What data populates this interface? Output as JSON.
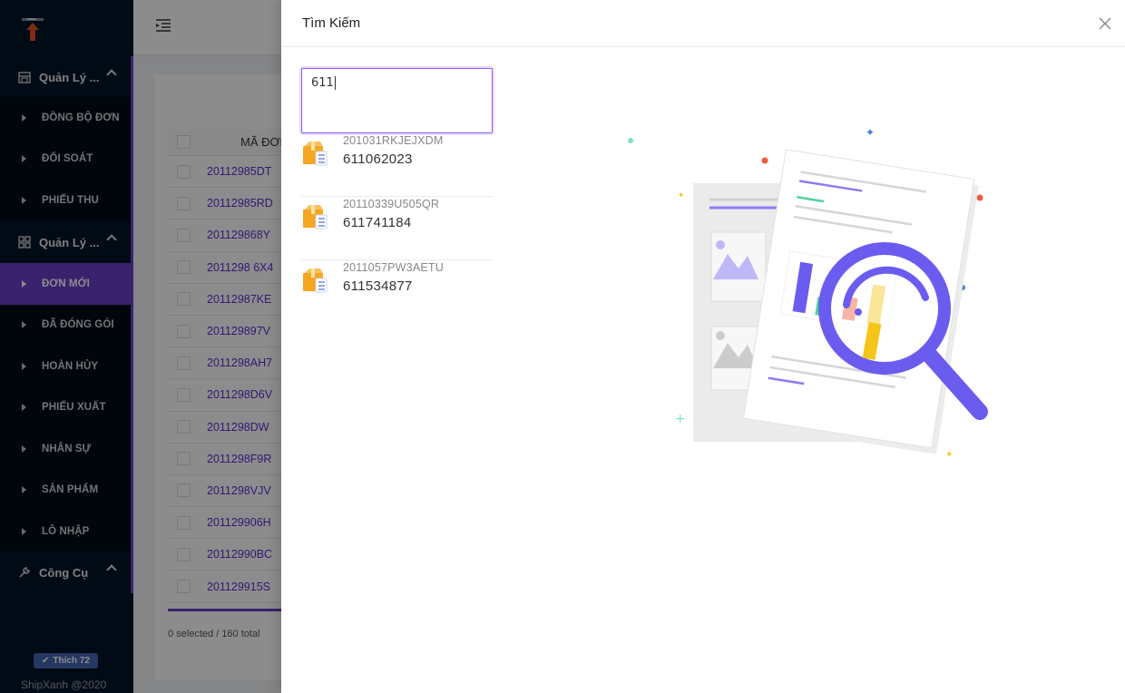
{
  "sidebar": {
    "groups": [
      {
        "label": "Quản Lý ...",
        "icon": "store-icon"
      },
      {
        "label": "Quản Lý ...",
        "icon": "grid-icon"
      },
      {
        "label": "Công Cụ",
        "icon": "wrench-icon"
      }
    ],
    "group1_items": [
      "ĐỒNG BỘ ĐƠN",
      "ĐỐI SOÁT",
      "PHIẾU THU"
    ],
    "group2_items": [
      "ĐƠN MỚI",
      "ĐÃ ĐÓNG GÓI",
      "HOÀN HỦY",
      "PHIẾU XUẤT",
      "NHÂN SỰ",
      "SẢN PHẨM",
      "LÔ NHẬP"
    ],
    "like_button": "Thích 72",
    "copyright": "ShipXanh @2020"
  },
  "table": {
    "header": "MÃ ĐƠN",
    "rows": [
      "20112985DT",
      "20112985RD",
      "201129868Y",
      "2011298 6X4",
      "20112987KE",
      "201129897V",
      "2011298AH7",
      "2011298D6V",
      "2011298DW",
      "2011298F9R",
      "2011298VJV",
      "201129906H",
      "20112990BC",
      "201129915S"
    ],
    "footer": "0 selected / 160 total"
  },
  "drawer": {
    "title": "Tìm Kiếm",
    "search_value": "611",
    "results": [
      {
        "code": "201031RKJEJXDM",
        "number": "611062023"
      },
      {
        "code": "20110339U505QR",
        "number": "611741184"
      },
      {
        "code": "2011057PW3AETU",
        "number": "611534877"
      }
    ]
  },
  "colors": {
    "accent": "#6a3fc9",
    "sidebar_bg": "#001529",
    "focus": "#8b5cf6"
  }
}
